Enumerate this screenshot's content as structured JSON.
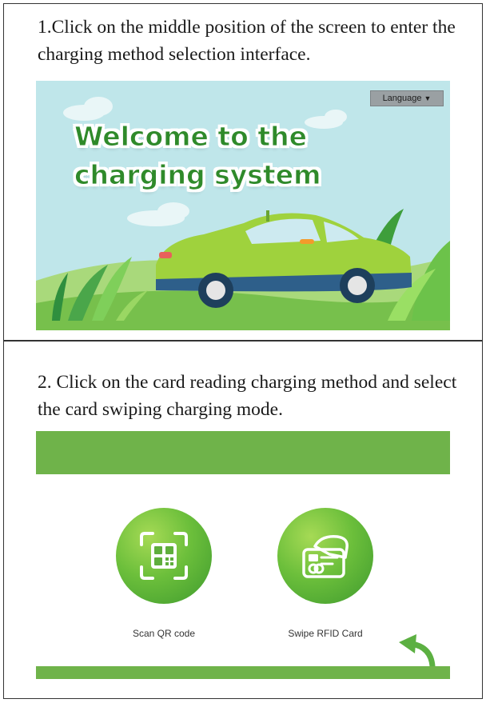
{
  "steps": [
    {
      "instruction": "1.Click on the middle position of the screen to enter the charging method selection interface.",
      "screen": {
        "language_label": "Language",
        "welcome_line1": "Welcome to the",
        "welcome_line2": "charging system"
      }
    },
    {
      "instruction": "2. Click on the card reading charging method and select the card swiping charging mode.",
      "screen": {
        "methods": [
          {
            "label": "Scan QR code",
            "icon": "qr-code-icon"
          },
          {
            "label": "Swipe RFID Card",
            "icon": "rfid-card-icon"
          }
        ],
        "back_icon": "back-arrow-icon"
      }
    }
  ],
  "colors": {
    "brand_green": "#6fb34a",
    "sky": "#bfe6ea",
    "welcome_text": "#2f8a2a"
  }
}
